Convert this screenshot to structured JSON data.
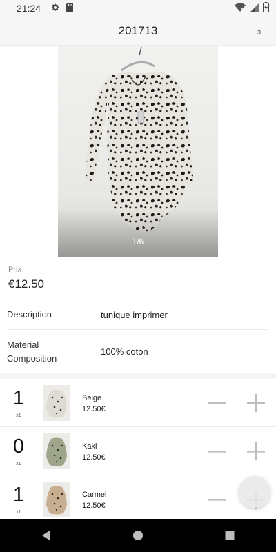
{
  "status_bar": {
    "time": "21:24",
    "icons": [
      "settings-gear-icon",
      "sd-card-icon",
      "wifi-off-icon",
      "cell-signal-icon",
      "battery-charging-icon"
    ]
  },
  "app_bar": {
    "title": "201713",
    "cart_count": "3"
  },
  "gallery": {
    "counter": "1/6"
  },
  "product": {
    "price_label": "Prix",
    "price_value": "€12.50",
    "description_label": "Description",
    "description_value": "tunique imprimer",
    "material_label": "Material Composition",
    "material_value": "100% coton"
  },
  "variants": [
    {
      "qty": "1",
      "multiplier": "x1",
      "name": "Beige",
      "price": "12.50€",
      "thumb_color": "#e6e2da"
    },
    {
      "qty": "0",
      "multiplier": "x1",
      "name": "Kaki",
      "price": "12.50€",
      "thumb_color": "#a6ab92"
    },
    {
      "qty": "1",
      "multiplier": "x1",
      "name": "Carmel",
      "price": "12.50€",
      "thumb_color": "#c8b39b"
    }
  ],
  "colors": {
    "accent_gray": "#bdbdbd",
    "nav_bar": "#000000"
  }
}
